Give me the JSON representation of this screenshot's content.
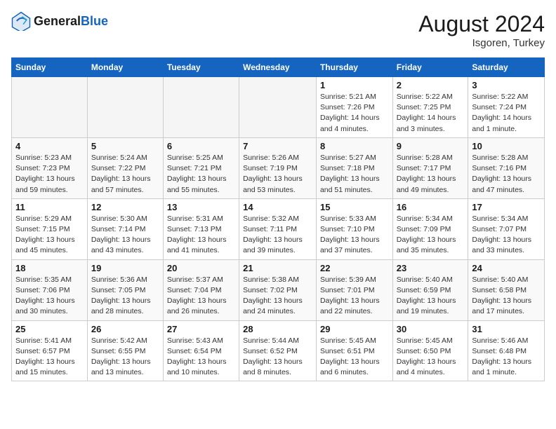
{
  "header": {
    "logo_general": "General",
    "logo_blue": "Blue",
    "month_year": "August 2024",
    "location": "Isgoren, Turkey"
  },
  "weekdays": [
    "Sunday",
    "Monday",
    "Tuesday",
    "Wednesday",
    "Thursday",
    "Friday",
    "Saturday"
  ],
  "weeks": [
    [
      {
        "day": "",
        "info": ""
      },
      {
        "day": "",
        "info": ""
      },
      {
        "day": "",
        "info": ""
      },
      {
        "day": "",
        "info": ""
      },
      {
        "day": "1",
        "info": "Sunrise: 5:21 AM\nSunset: 7:26 PM\nDaylight: 14 hours\nand 4 minutes."
      },
      {
        "day": "2",
        "info": "Sunrise: 5:22 AM\nSunset: 7:25 PM\nDaylight: 14 hours\nand 3 minutes."
      },
      {
        "day": "3",
        "info": "Sunrise: 5:22 AM\nSunset: 7:24 PM\nDaylight: 14 hours\nand 1 minute."
      }
    ],
    [
      {
        "day": "4",
        "info": "Sunrise: 5:23 AM\nSunset: 7:23 PM\nDaylight: 13 hours\nand 59 minutes."
      },
      {
        "day": "5",
        "info": "Sunrise: 5:24 AM\nSunset: 7:22 PM\nDaylight: 13 hours\nand 57 minutes."
      },
      {
        "day": "6",
        "info": "Sunrise: 5:25 AM\nSunset: 7:21 PM\nDaylight: 13 hours\nand 55 minutes."
      },
      {
        "day": "7",
        "info": "Sunrise: 5:26 AM\nSunset: 7:19 PM\nDaylight: 13 hours\nand 53 minutes."
      },
      {
        "day": "8",
        "info": "Sunrise: 5:27 AM\nSunset: 7:18 PM\nDaylight: 13 hours\nand 51 minutes."
      },
      {
        "day": "9",
        "info": "Sunrise: 5:28 AM\nSunset: 7:17 PM\nDaylight: 13 hours\nand 49 minutes."
      },
      {
        "day": "10",
        "info": "Sunrise: 5:28 AM\nSunset: 7:16 PM\nDaylight: 13 hours\nand 47 minutes."
      }
    ],
    [
      {
        "day": "11",
        "info": "Sunrise: 5:29 AM\nSunset: 7:15 PM\nDaylight: 13 hours\nand 45 minutes."
      },
      {
        "day": "12",
        "info": "Sunrise: 5:30 AM\nSunset: 7:14 PM\nDaylight: 13 hours\nand 43 minutes."
      },
      {
        "day": "13",
        "info": "Sunrise: 5:31 AM\nSunset: 7:13 PM\nDaylight: 13 hours\nand 41 minutes."
      },
      {
        "day": "14",
        "info": "Sunrise: 5:32 AM\nSunset: 7:11 PM\nDaylight: 13 hours\nand 39 minutes."
      },
      {
        "day": "15",
        "info": "Sunrise: 5:33 AM\nSunset: 7:10 PM\nDaylight: 13 hours\nand 37 minutes."
      },
      {
        "day": "16",
        "info": "Sunrise: 5:34 AM\nSunset: 7:09 PM\nDaylight: 13 hours\nand 35 minutes."
      },
      {
        "day": "17",
        "info": "Sunrise: 5:34 AM\nSunset: 7:07 PM\nDaylight: 13 hours\nand 33 minutes."
      }
    ],
    [
      {
        "day": "18",
        "info": "Sunrise: 5:35 AM\nSunset: 7:06 PM\nDaylight: 13 hours\nand 30 minutes."
      },
      {
        "day": "19",
        "info": "Sunrise: 5:36 AM\nSunset: 7:05 PM\nDaylight: 13 hours\nand 28 minutes."
      },
      {
        "day": "20",
        "info": "Sunrise: 5:37 AM\nSunset: 7:04 PM\nDaylight: 13 hours\nand 26 minutes."
      },
      {
        "day": "21",
        "info": "Sunrise: 5:38 AM\nSunset: 7:02 PM\nDaylight: 13 hours\nand 24 minutes."
      },
      {
        "day": "22",
        "info": "Sunrise: 5:39 AM\nSunset: 7:01 PM\nDaylight: 13 hours\nand 22 minutes."
      },
      {
        "day": "23",
        "info": "Sunrise: 5:40 AM\nSunset: 6:59 PM\nDaylight: 13 hours\nand 19 minutes."
      },
      {
        "day": "24",
        "info": "Sunrise: 5:40 AM\nSunset: 6:58 PM\nDaylight: 13 hours\nand 17 minutes."
      }
    ],
    [
      {
        "day": "25",
        "info": "Sunrise: 5:41 AM\nSunset: 6:57 PM\nDaylight: 13 hours\nand 15 minutes."
      },
      {
        "day": "26",
        "info": "Sunrise: 5:42 AM\nSunset: 6:55 PM\nDaylight: 13 hours\nand 13 minutes."
      },
      {
        "day": "27",
        "info": "Sunrise: 5:43 AM\nSunset: 6:54 PM\nDaylight: 13 hours\nand 10 minutes."
      },
      {
        "day": "28",
        "info": "Sunrise: 5:44 AM\nSunset: 6:52 PM\nDaylight: 13 hours\nand 8 minutes."
      },
      {
        "day": "29",
        "info": "Sunrise: 5:45 AM\nSunset: 6:51 PM\nDaylight: 13 hours\nand 6 minutes."
      },
      {
        "day": "30",
        "info": "Sunrise: 5:45 AM\nSunset: 6:50 PM\nDaylight: 13 hours\nand 4 minutes."
      },
      {
        "day": "31",
        "info": "Sunrise: 5:46 AM\nSunset: 6:48 PM\nDaylight: 13 hours\nand 1 minute."
      }
    ]
  ]
}
